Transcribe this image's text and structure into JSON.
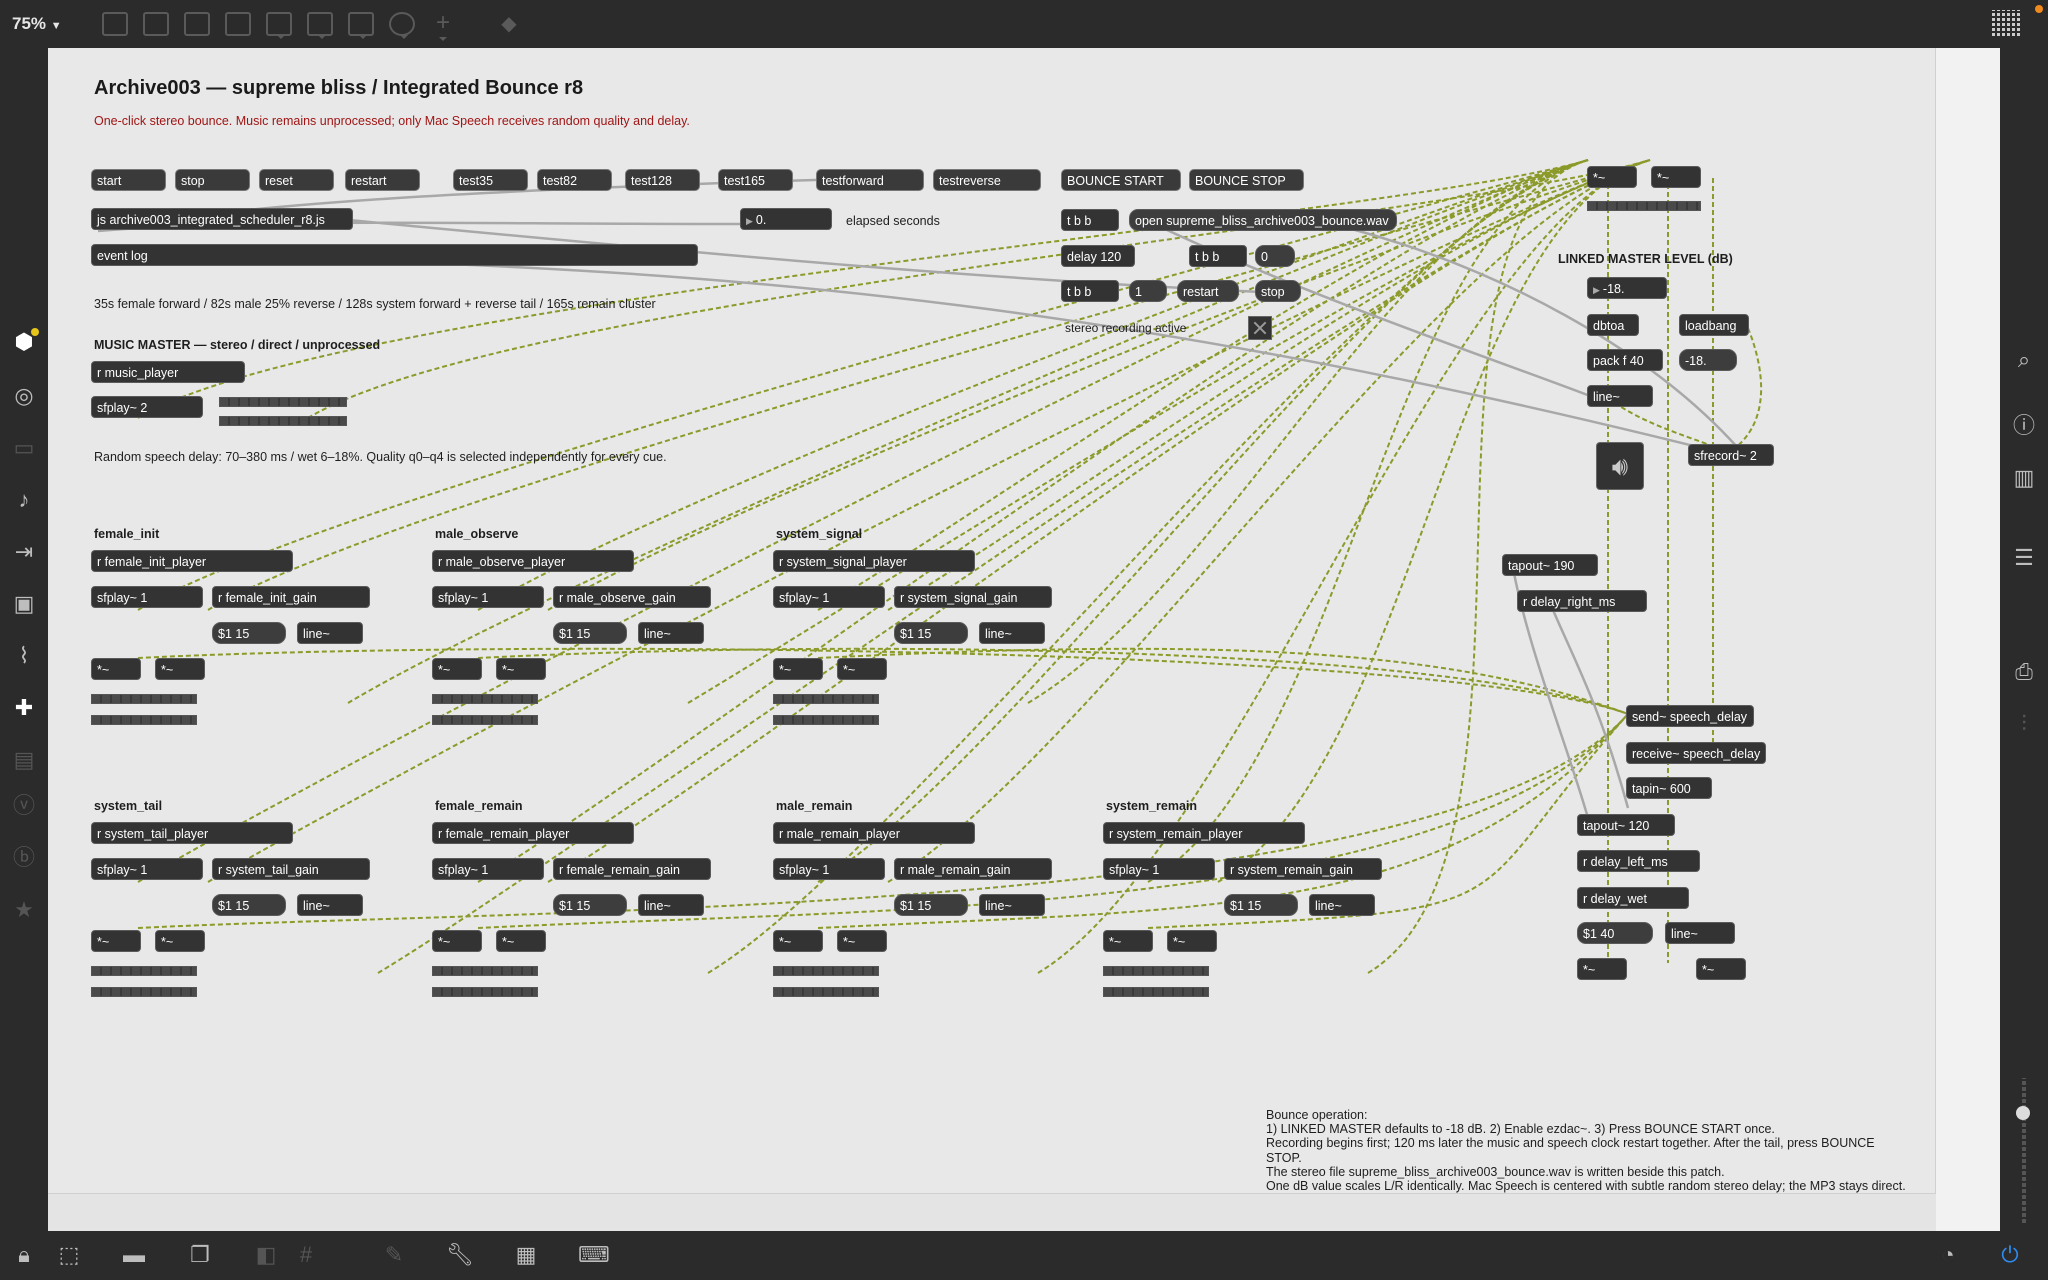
{
  "toolbar": {
    "zoom": "75%",
    "zoom_arrow": "▼",
    "icons": [
      "patcher-icon",
      "comment-icon",
      "chat-icon",
      "x-box-icon",
      "camera-icon",
      "play-box-icon",
      "split-icon",
      "dial-icon",
      "plus-icon",
      "paint-bucket-icon"
    ],
    "right_icon": "grid-icon"
  },
  "left_sidebar": [
    "package-icon",
    "target-icon",
    "keyboard-icon",
    "music-note-icon",
    "play-step-icon",
    "image-icon",
    "paperclip-icon",
    "plugin-icon",
    "box-icon",
    "v-icon",
    "b-icon",
    "star-icon"
  ],
  "right_sidebar": [
    "search-icon",
    "info-icon",
    "book-icon",
    "list-icon",
    "camera-icon",
    "sliders-icon"
  ],
  "bottom_bar": [
    "lock-icon",
    "edit-icon",
    "speech-bubble-icon",
    "windows-icon",
    "mute-icon",
    "grid-icon",
    "pin-icon",
    "wrench-icon",
    "keyboard-icon",
    "keyboard-small-icon",
    "clock-icon",
    "power-icon"
  ],
  "patch": {
    "title": "Archive003 — supreme bliss / Integrated Bounce r8",
    "subtitle": "One-click stereo bounce. Music remains unprocessed; only Mac Speech receives random quality and delay.",
    "transport_buttons": [
      "start",
      "stop",
      "reset",
      "restart",
      "test35",
      "test82",
      "test128",
      "test165",
      "testforward",
      "testreverse"
    ],
    "scheduler": "js archive003_integrated_scheduler_r8.js",
    "elapsed_value": "0.",
    "elapsed_label": "elapsed seconds",
    "event_log": "event log",
    "schedule_note": "35s female forward / 82s male 25% reverse / 128s system forward + reverse tail / 165s remain cluster",
    "music_master": {
      "label": "MUSIC MASTER — stereo / direct / unprocessed",
      "receive": "r music_player",
      "player": "sfplay~ 2"
    },
    "speech_note": "Random speech delay: 70–380 ms / wet 6–18%. Quality q0–q4 is selected independently for every cue.",
    "voices": [
      {
        "name": "female_init",
        "receive": "r female_init_player",
        "player": "sfplay~ 1",
        "gain": "r female_init_gain",
        "msg": "$1 15",
        "line": "line~",
        "mul": "*~"
      },
      {
        "name": "male_observe",
        "receive": "r male_observe_player",
        "player": "sfplay~ 1",
        "gain": "r male_observe_gain",
        "msg": "$1 15",
        "line": "line~",
        "mul": "*~"
      },
      {
        "name": "system_signal",
        "receive": "r system_signal_player",
        "player": "sfplay~ 1",
        "gain": "r system_signal_gain",
        "msg": "$1 15",
        "line": "line~",
        "mul": "*~"
      },
      {
        "name": "system_tail",
        "receive": "r system_tail_player",
        "player": "sfplay~ 1",
        "gain": "r system_tail_gain",
        "msg": "$1 15",
        "line": "line~",
        "mul": "*~"
      },
      {
        "name": "female_remain",
        "receive": "r female_remain_player",
        "player": "sfplay~ 1",
        "gain": "r female_remain_gain",
        "msg": "$1 15",
        "line": "line~",
        "mul": "*~"
      },
      {
        "name": "male_remain",
        "receive": "r male_remain_player",
        "player": "sfplay~ 1",
        "gain": "r male_remain_gain",
        "msg": "$1 15",
        "line": "line~",
        "mul": "*~"
      },
      {
        "name": "system_remain",
        "receive": "r system_remain_player",
        "player": "sfplay~ 1",
        "gain": "r system_remain_gain",
        "msg": "$1 15",
        "line": "line~",
        "mul": "*~"
      }
    ],
    "bounce": {
      "start": "BOUNCE START",
      "stop": "BOUNCE STOP",
      "tbb1": "t b b",
      "open_msg": "open supreme_bliss_archive003_bounce.wav",
      "delay": "delay 120",
      "tbb2": "t b b",
      "zero": "0",
      "tbb3": "t b b",
      "one": "1",
      "restart": "restart",
      "stop_msg": "stop",
      "recording_label": "stereo recording active"
    },
    "master": {
      "mul_l": "*~",
      "mul_r": "*~",
      "label": "LINKED MASTER LEVEL (dB)",
      "db_value": "-18.",
      "dbtoa": "dbtoa",
      "loadbang": "loadbang",
      "pack": "pack f 40",
      "default_msg": "-18.",
      "line": "line~",
      "sfrecord": "sfrecord~ 2",
      "ezdac": "speaker-icon"
    },
    "delay_section": {
      "tapout_r": "tapout~ 190",
      "delay_right": "r delay_right_ms",
      "send": "send~ speech_delay",
      "receive": "receive~ speech_delay",
      "tapin": "tapin~ 600",
      "tapout_l": "tapout~ 120",
      "delay_left": "r delay_left_ms",
      "delay_wet": "r delay_wet",
      "msg": "$1 40",
      "line": "line~",
      "mul_l": "*~",
      "mul_r": "*~"
    },
    "notes": [
      "Bounce operation:",
      "1) LINKED MASTER defaults to -18 dB.  2) Enable ezdac~.  3) Press BOUNCE START once.",
      "Recording begins first; 120 ms later the music and speech clock restart together. After the tail, press BOUNCE STOP.",
      "The stereo file supreme_bliss_archive003_bounce.wav is written beside this patch.",
      "One dB value scales L/R identically. Mac Speech is centered with subtle random stereo delay; the MP3 stays direct."
    ]
  }
}
